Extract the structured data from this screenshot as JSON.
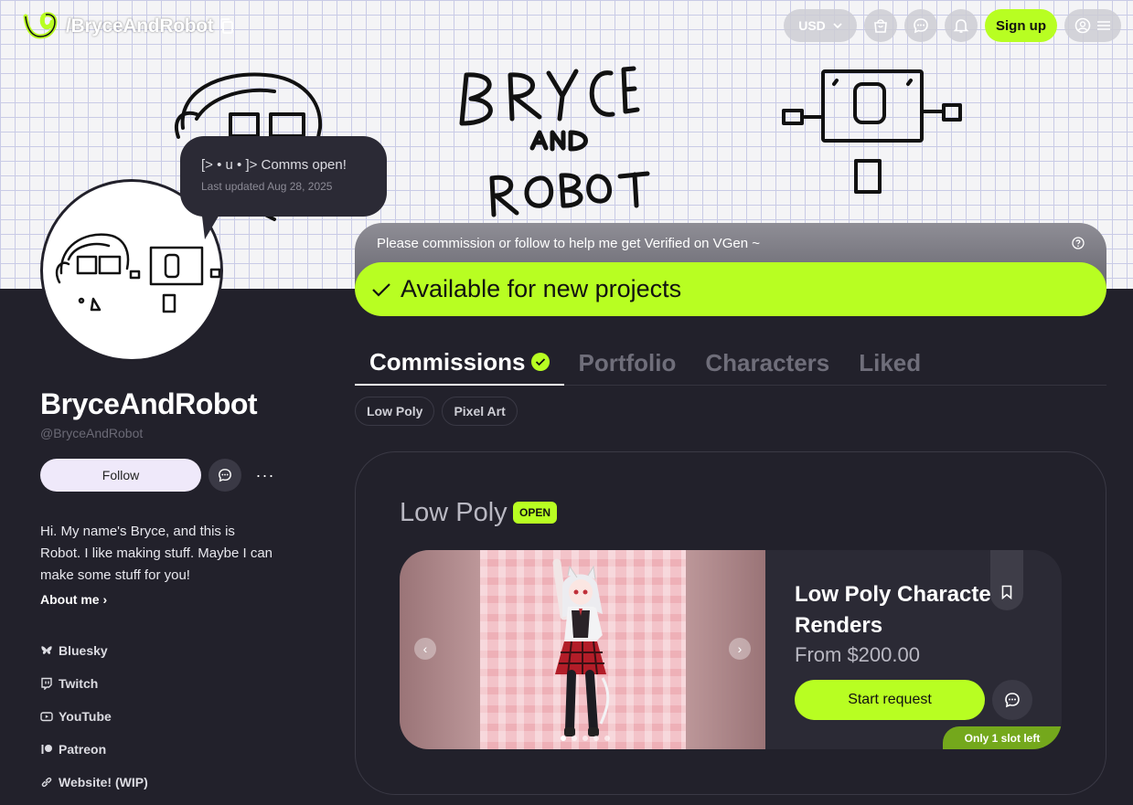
{
  "header": {
    "handle": "/BryceAndRobot",
    "currency": "USD",
    "signup_label": "Sign up"
  },
  "status_bubble": {
    "text": "[> • u • ]> Comms open!",
    "updated": "Last updated Aug 28, 2025"
  },
  "profile": {
    "name": "BryceAndRobot",
    "username": "@BryceAndRobot",
    "follow_label": "Follow",
    "more_label": "···",
    "bio": "Hi. My name's Bryce, and this is Robot. I like making stuff. Maybe I can make some stuff for you!",
    "about_label": "About me ›",
    "links": [
      {
        "label": "Bluesky",
        "icon": "butterfly-icon"
      },
      {
        "label": "Twitch",
        "icon": "twitch-icon"
      },
      {
        "label": "YouTube",
        "icon": "youtube-icon"
      },
      {
        "label": "Patreon",
        "icon": "patreon-icon"
      },
      {
        "label": "Website! (WIP)",
        "icon": "link-icon"
      }
    ]
  },
  "verify": {
    "text": "Please commission or follow to help me get Verified on VGen ~",
    "available": "Available for new projects"
  },
  "tabs": [
    "Commissions",
    "Portfolio",
    "Characters",
    "Liked"
  ],
  "chips": [
    "Low Poly",
    "Pixel Art"
  ],
  "section": {
    "title": "Low Poly",
    "badge": "OPEN",
    "card": {
      "title": "Low Poly Character Renders",
      "price": "From $200.00",
      "start_label": "Start request",
      "slot_label": "Only 1 slot left",
      "image_index": 1,
      "image_count": 5
    }
  },
  "colors": {
    "accent": "#b8fe22",
    "background": "#22212b",
    "card": "#2b2a35"
  }
}
